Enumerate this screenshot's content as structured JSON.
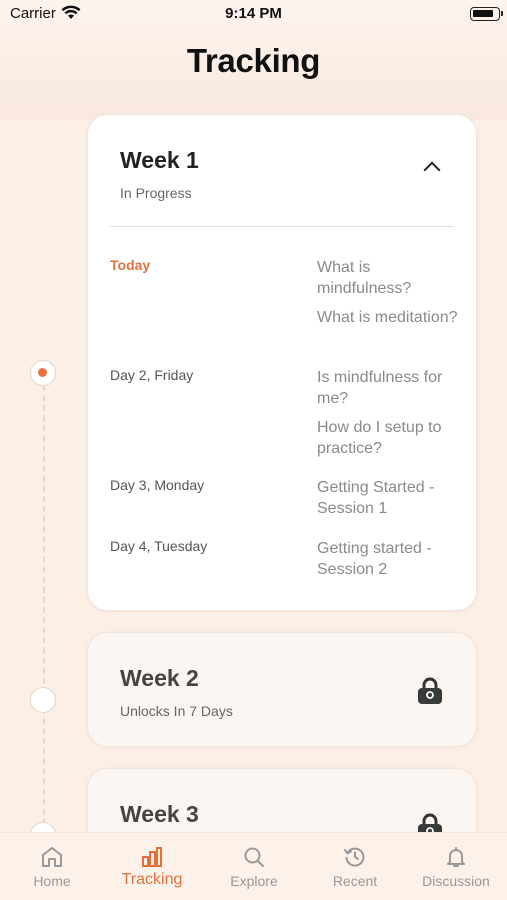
{
  "status_bar": {
    "carrier": "Carrier",
    "time": "9:14 PM",
    "battery_level": 0.85
  },
  "header": {
    "title": "Tracking"
  },
  "weeks": [
    {
      "title": "Week 1",
      "status": "In Progress",
      "expanded": true,
      "sessions": [
        {
          "day": "Today",
          "lessons": [
            "What is mindfulness?",
            "What is meditation?"
          ]
        },
        {
          "day": "Day 2, Friday",
          "lessons": [
            "Is mindfulness for me?",
            "How do I setup to practice?"
          ]
        },
        {
          "day": "Day 3, Monday",
          "lessons": [
            "Getting Started - Session 1"
          ]
        },
        {
          "day": "Day 4, Tuesday",
          "lessons": [
            "Getting started - Session 2"
          ]
        }
      ]
    },
    {
      "title": "Week 2",
      "status": "Unlocks In 7 Days",
      "locked": true
    },
    {
      "title": "Week 3",
      "locked": true
    }
  ],
  "tabs": [
    {
      "label": "Home",
      "icon": "home-icon"
    },
    {
      "label": "Tracking",
      "icon": "bar-chart-icon",
      "active": true
    },
    {
      "label": "Explore",
      "icon": "search-icon"
    },
    {
      "label": "Recent",
      "icon": "history-icon"
    },
    {
      "label": "Discussion",
      "icon": "bell-icon"
    }
  ],
  "colors": {
    "accent": "#e5703a",
    "background": "#fbefe6",
    "card": "#ffffff"
  }
}
